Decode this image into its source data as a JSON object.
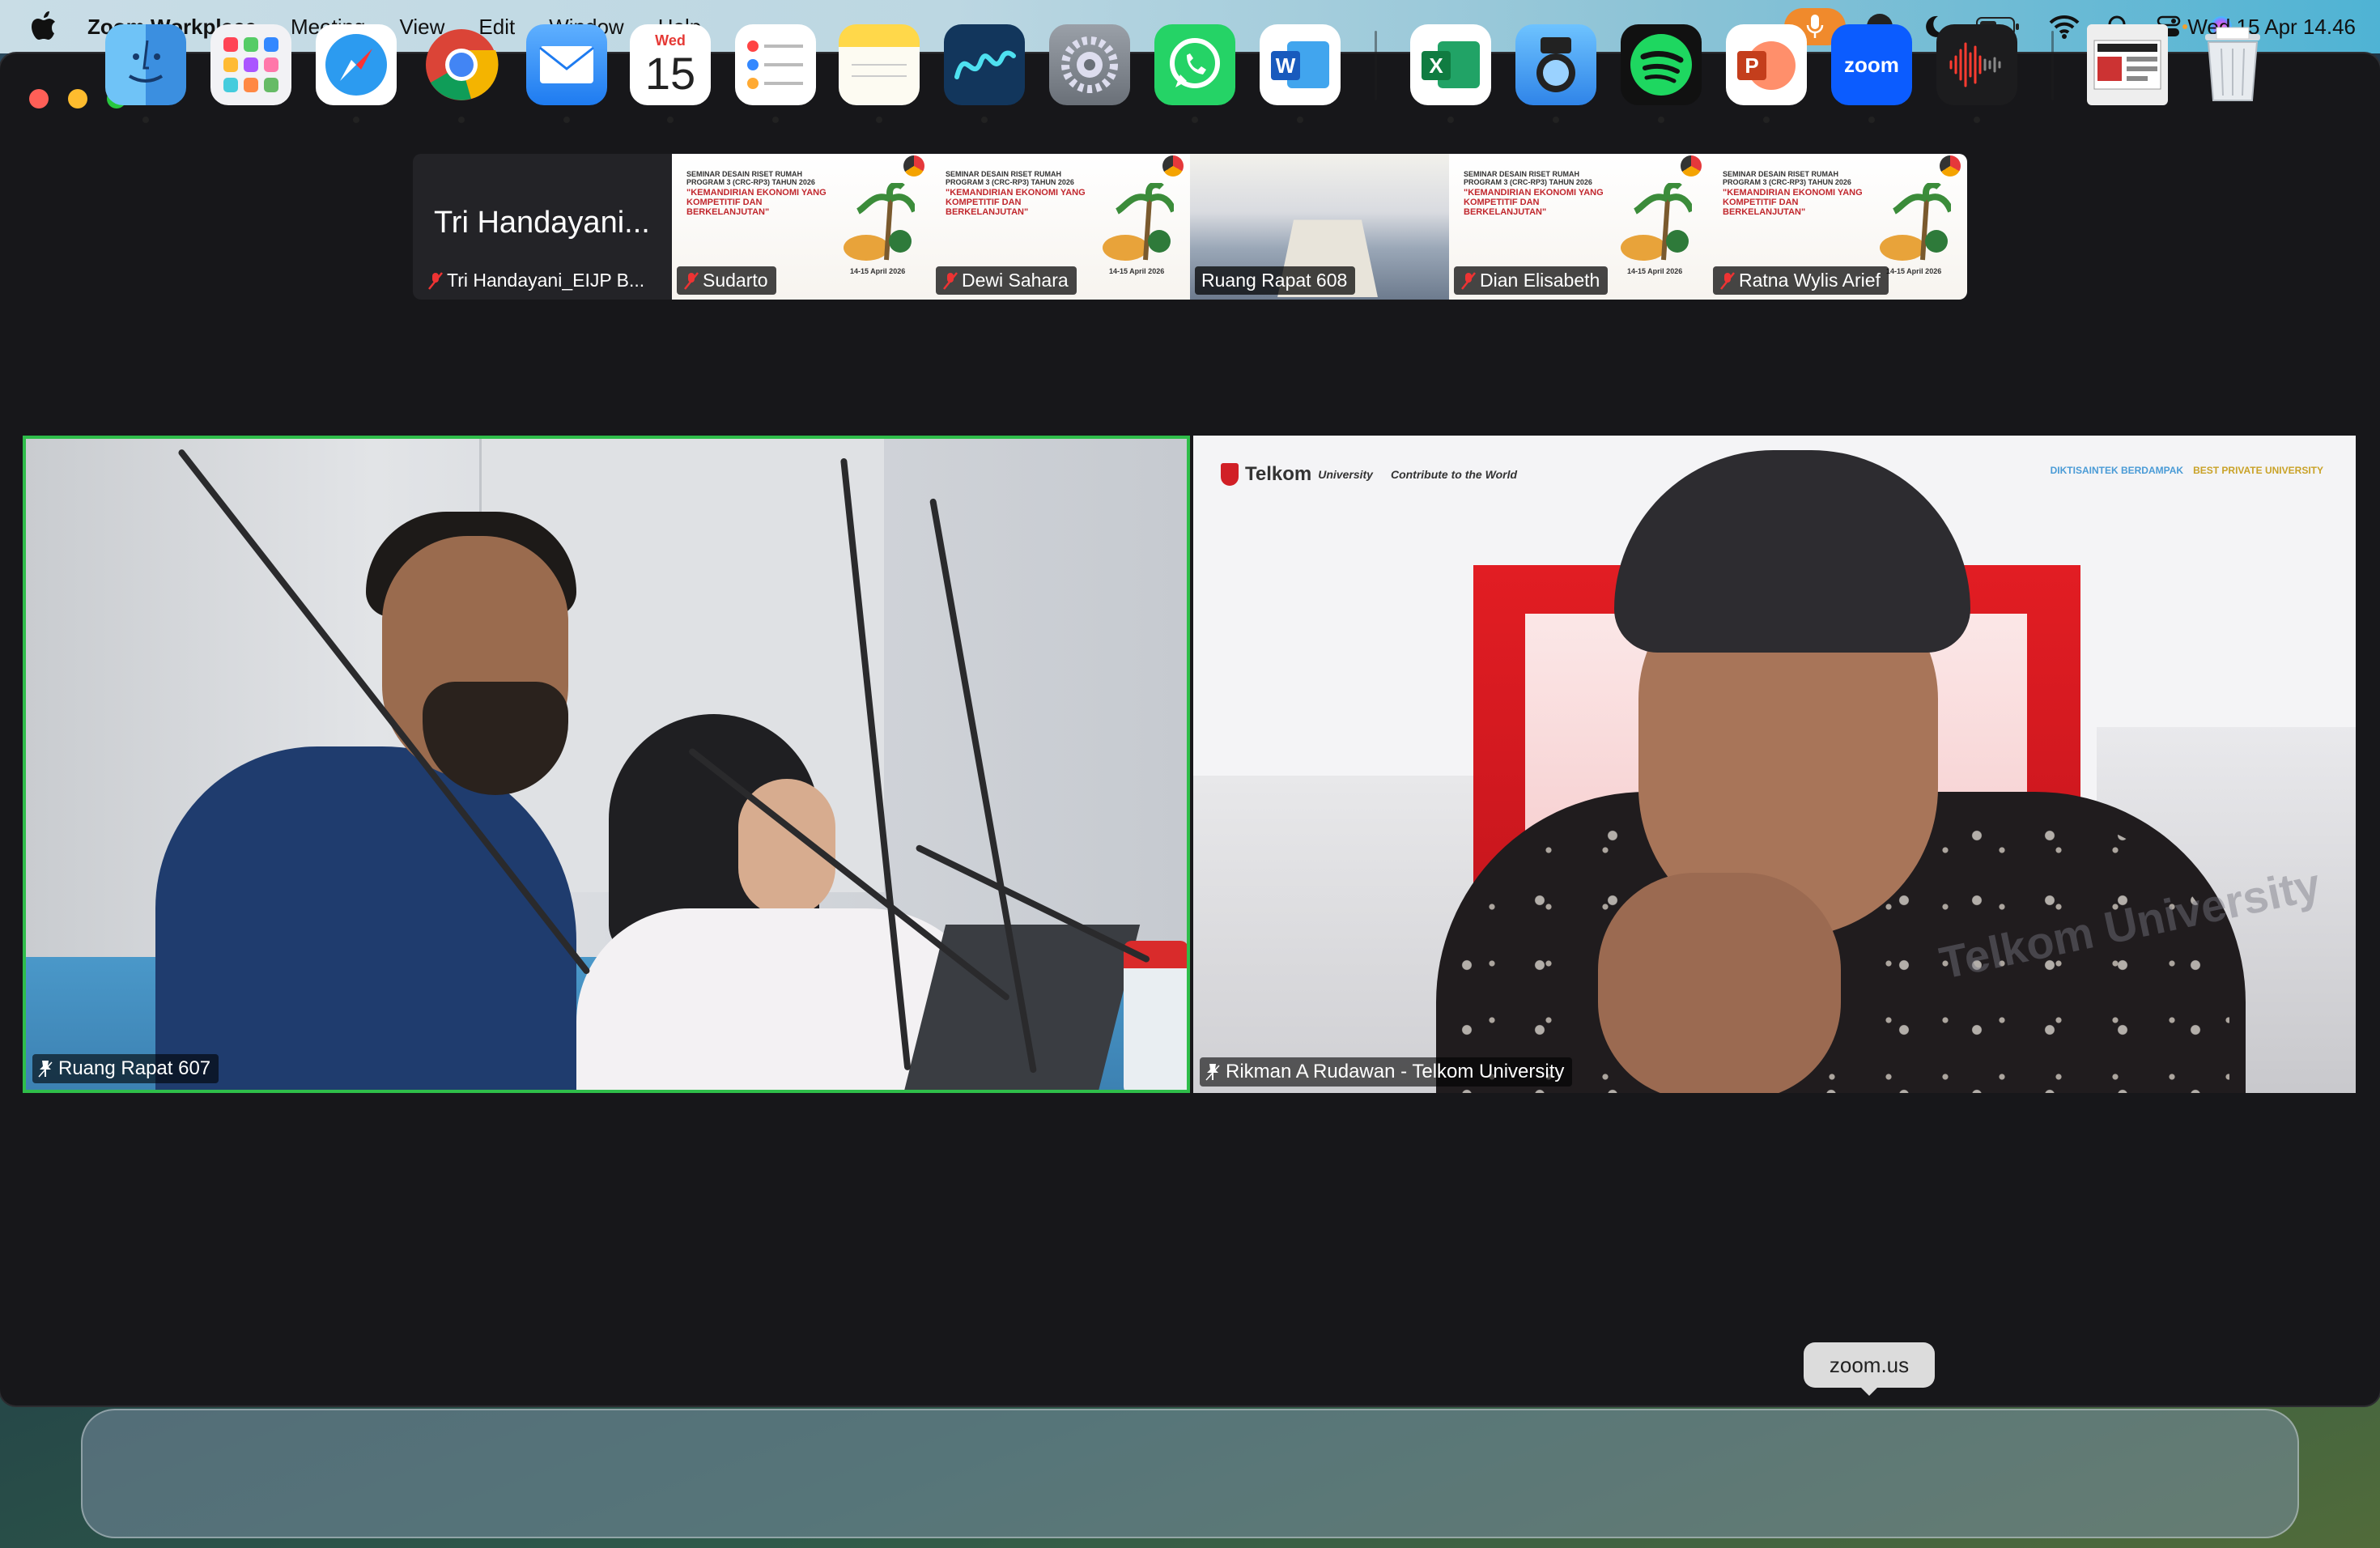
{
  "menubar": {
    "app_name": "Zoom Workplace",
    "menus": [
      "Meeting",
      "View",
      "Edit",
      "Window",
      "Help"
    ],
    "clock": "Wed 15 Apr  14.46",
    "icons": [
      "microphone-icon",
      "zoom-menu-icon",
      "moon-icon",
      "battery-icon",
      "wifi-icon",
      "search-icon",
      "control-center-icon",
      "siri-icon"
    ],
    "mic_color": "#f08a2c"
  },
  "gallery": {
    "first_tile_big_name": "Tri Handayani...",
    "thumbnails": [
      {
        "label": "Tri Handayani_EIJP B...",
        "muted": true,
        "type": "name"
      },
      {
        "label": "Sudarto",
        "muted": true,
        "type": "poster"
      },
      {
        "label": "Dewi Sahara",
        "muted": true,
        "type": "poster"
      },
      {
        "label": "Ruang Rapat 608",
        "muted": false,
        "type": "room"
      },
      {
        "label": "Dian Elisabeth",
        "muted": true,
        "type": "poster"
      },
      {
        "label": "Ratna Wylis Arief",
        "muted": true,
        "type": "poster"
      }
    ],
    "poster": {
      "line1": "SEMINAR DESAIN RISET RUMAH PROGRAM 3 (CRC-RP3) TAHUN 2026",
      "line2": "\"KEMANDIRIAN EKONOMI YANG KOMPETITIF DAN BERKELANJUTAN\"",
      "date": "14-15 April 2026"
    }
  },
  "main_tiles": [
    {
      "label": "Ruang Rapat 607",
      "active_speaker": true
    },
    {
      "label": "Rikman A Rudawan - Telkom University",
      "active_speaker": false
    }
  ],
  "background_branding": {
    "university": "Telkom",
    "university_sub": "University",
    "tagline": "Contribute to the World",
    "right_logo_1": "DIKTISAINTEK BERDAMPAK",
    "right_logo_2": "BEST PRIVATE UNIVERSITY",
    "watermark": "Telkom University"
  },
  "tooltip": "zoom.us",
  "dock": {
    "apps": [
      {
        "name": "finder-icon",
        "running": true
      },
      {
        "name": "launchpad-icon",
        "running": false
      },
      {
        "name": "safari-icon",
        "running": true
      },
      {
        "name": "chrome-icon",
        "running": true
      },
      {
        "name": "mail-icon",
        "running": true
      },
      {
        "name": "calendar-icon",
        "running": true
      },
      {
        "name": "reminders-icon",
        "running": true
      },
      {
        "name": "notes-icon",
        "running": true
      },
      {
        "name": "freeform-icon",
        "running": true
      },
      {
        "name": "system-settings-icon",
        "running": false
      },
      {
        "name": "whatsapp-icon",
        "running": true
      },
      {
        "name": "word-icon",
        "running": true
      },
      {
        "name": "excel-icon",
        "running": true
      },
      {
        "name": "preview-icon",
        "running": true
      },
      {
        "name": "spotify-icon",
        "running": true
      },
      {
        "name": "powerpoint-icon",
        "running": true
      },
      {
        "name": "zoom-icon",
        "running": true
      },
      {
        "name": "voice-memos-icon",
        "running": true
      },
      {
        "name": "downloads-stack-icon",
        "running": false
      },
      {
        "name": "trash-icon",
        "running": false
      }
    ],
    "calendar": {
      "day": "Wed",
      "date": "15"
    },
    "zoom_label": "zoom"
  }
}
